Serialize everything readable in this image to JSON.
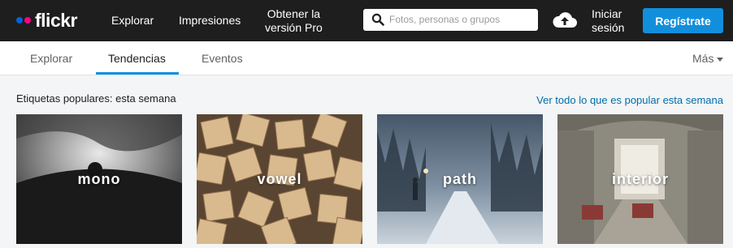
{
  "header": {
    "logo_text": "flickr",
    "nav": {
      "explorar": "Explorar",
      "impresiones": "Impresiones",
      "pro_line1": "Obtener la",
      "pro_line2": "versión Pro"
    },
    "search_placeholder": "Fotos, personas o grupos",
    "signin_line1": "Iniciar",
    "signin_line2": "sesión",
    "register": "Regístrate"
  },
  "subnav": {
    "tabs": [
      {
        "label": "Explorar"
      },
      {
        "label": "Tendencias",
        "active": true
      },
      {
        "label": "Eventos"
      }
    ],
    "more": "Más"
  },
  "section": {
    "title": "Etiquetas populares: esta semana",
    "see_all": "Ver todo lo que es popular esta semana"
  },
  "tags": [
    {
      "label": "mono"
    },
    {
      "label": "vowel"
    },
    {
      "label": "path"
    },
    {
      "label": "interior"
    }
  ],
  "colors": {
    "topbar": "#1e1e1e",
    "accent_blue": "#128fdc",
    "logo_blue": "#0063dc",
    "logo_pink": "#ff0084",
    "link": "#006dac"
  }
}
